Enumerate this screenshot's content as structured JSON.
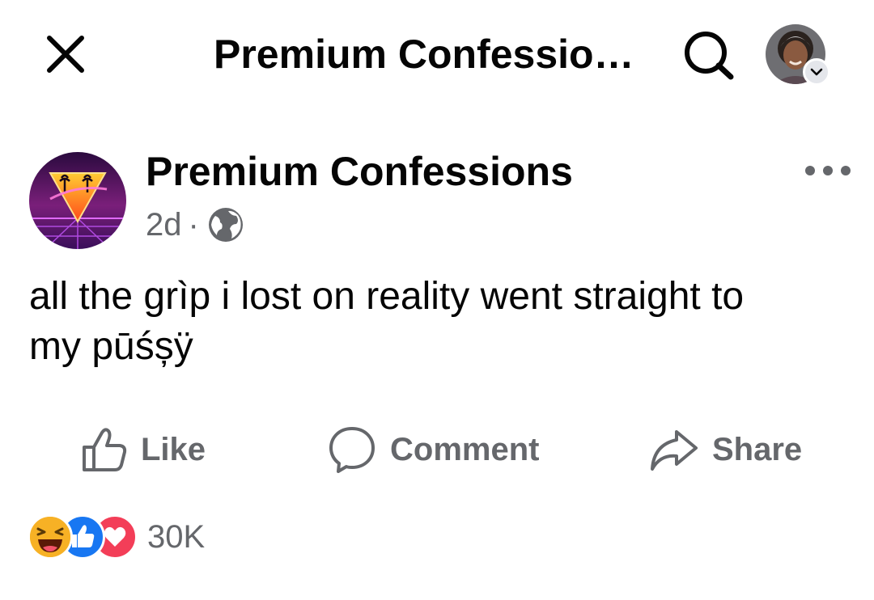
{
  "header": {
    "title": "Premium Confessio…",
    "close_icon": "close-icon",
    "search_icon": "search-icon",
    "profile_icon": "profile-avatar"
  },
  "post": {
    "page_name": "Premium Confessions",
    "time": "2d",
    "separator": "·",
    "audience_icon": "globe-icon",
    "more_icon": "more-horizontal-icon",
    "text": "all the grìp i lost on reality went straight to\nmy pūśșÿ"
  },
  "actions": {
    "like_label": "Like",
    "comment_label": "Comment",
    "share_label": "Share"
  },
  "reactions": {
    "types": [
      "haha",
      "like",
      "love"
    ],
    "count": "30K"
  },
  "colors": {
    "text_primary": "#050505",
    "text_secondary": "#65676b",
    "like_blue": "#1877f2",
    "love_red": "#f33e58",
    "haha_yellow": "#f7b125"
  }
}
